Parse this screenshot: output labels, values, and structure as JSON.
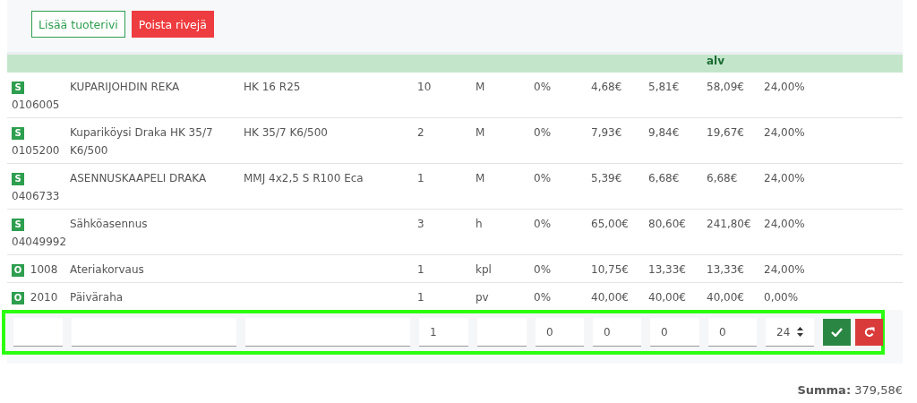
{
  "toolbar": {
    "buttons": [
      {
        "label": "Lisää tuoterivi",
        "kind": "add"
      },
      {
        "label": "Poista rivejä",
        "kind": "delete"
      }
    ]
  },
  "table": {
    "header": {
      "column_9": "alv"
    },
    "rows": [
      {
        "badge": "S",
        "code": "0106005",
        "name": "KUPARIJOHDIN REKA",
        "spec": "HK 16 R25",
        "quantity": "10",
        "unit": "M",
        "discount": "0%",
        "price": "4,68€",
        "price_vat": "5,81€",
        "total": "58,09€",
        "vat": "24,00%"
      },
      {
        "badge": "S",
        "code": "0105200",
        "name": "Kupariköysi Draka HK 35/7 K6/500",
        "spec": "HK 35/7 K6/500",
        "quantity": "2",
        "unit": "M",
        "discount": "0%",
        "price": "7,93€",
        "price_vat": "9,84€",
        "total": "19,67€",
        "vat": "24,00%"
      },
      {
        "badge": "S",
        "code": "0406733",
        "name": "ASENNUSKAAPELI DRAKA",
        "spec": "MMJ 4x2,5 S R100 Eca",
        "quantity": "1",
        "unit": "M",
        "discount": "0%",
        "price": "5,39€",
        "price_vat": "6,68€",
        "total": "6,68€",
        "vat": "24,00%"
      },
      {
        "badge": "S",
        "code": "04049992",
        "name": "Sähköasennus",
        "spec": "",
        "quantity": "3",
        "unit": "h",
        "discount": "0%",
        "price": "65,00€",
        "price_vat": "80,60€",
        "total": "241,80€",
        "vat": "24,00%"
      },
      {
        "badge": "O",
        "code": "1008",
        "name": "Ateriakorvaus",
        "spec": "",
        "quantity": "1",
        "unit": "kpl",
        "discount": "0%",
        "price": "10,75€",
        "price_vat": "13,33€",
        "total": "13,33€",
        "vat": "24,00%"
      },
      {
        "badge": "O",
        "code": "2010",
        "name": "Päiväraha",
        "spec": "",
        "quantity": "1",
        "unit": "pv",
        "discount": "0%",
        "price": "40,00€",
        "price_vat": "40,00€",
        "total": "40,00€",
        "vat": "0,00%"
      }
    ]
  },
  "edit_row": {
    "highlighted": true,
    "fields": [
      {
        "kind": "text"
      },
      {
        "kind": "text"
      },
      {
        "kind": "text"
      },
      {
        "kind": "text",
        "value": "1"
      },
      {
        "kind": "text"
      },
      {
        "kind": "text",
        "value": "0"
      },
      {
        "kind": "text",
        "value": "0"
      },
      {
        "kind": "text",
        "value": "0"
      },
      {
        "kind": "text",
        "value": "0"
      },
      {
        "kind": "select",
        "value": "24"
      }
    ],
    "actions": [
      {
        "kind": "save"
      },
      {
        "kind": "undo"
      }
    ]
  },
  "summary": {
    "label": "Summa:",
    "value": "379,58€"
  }
}
